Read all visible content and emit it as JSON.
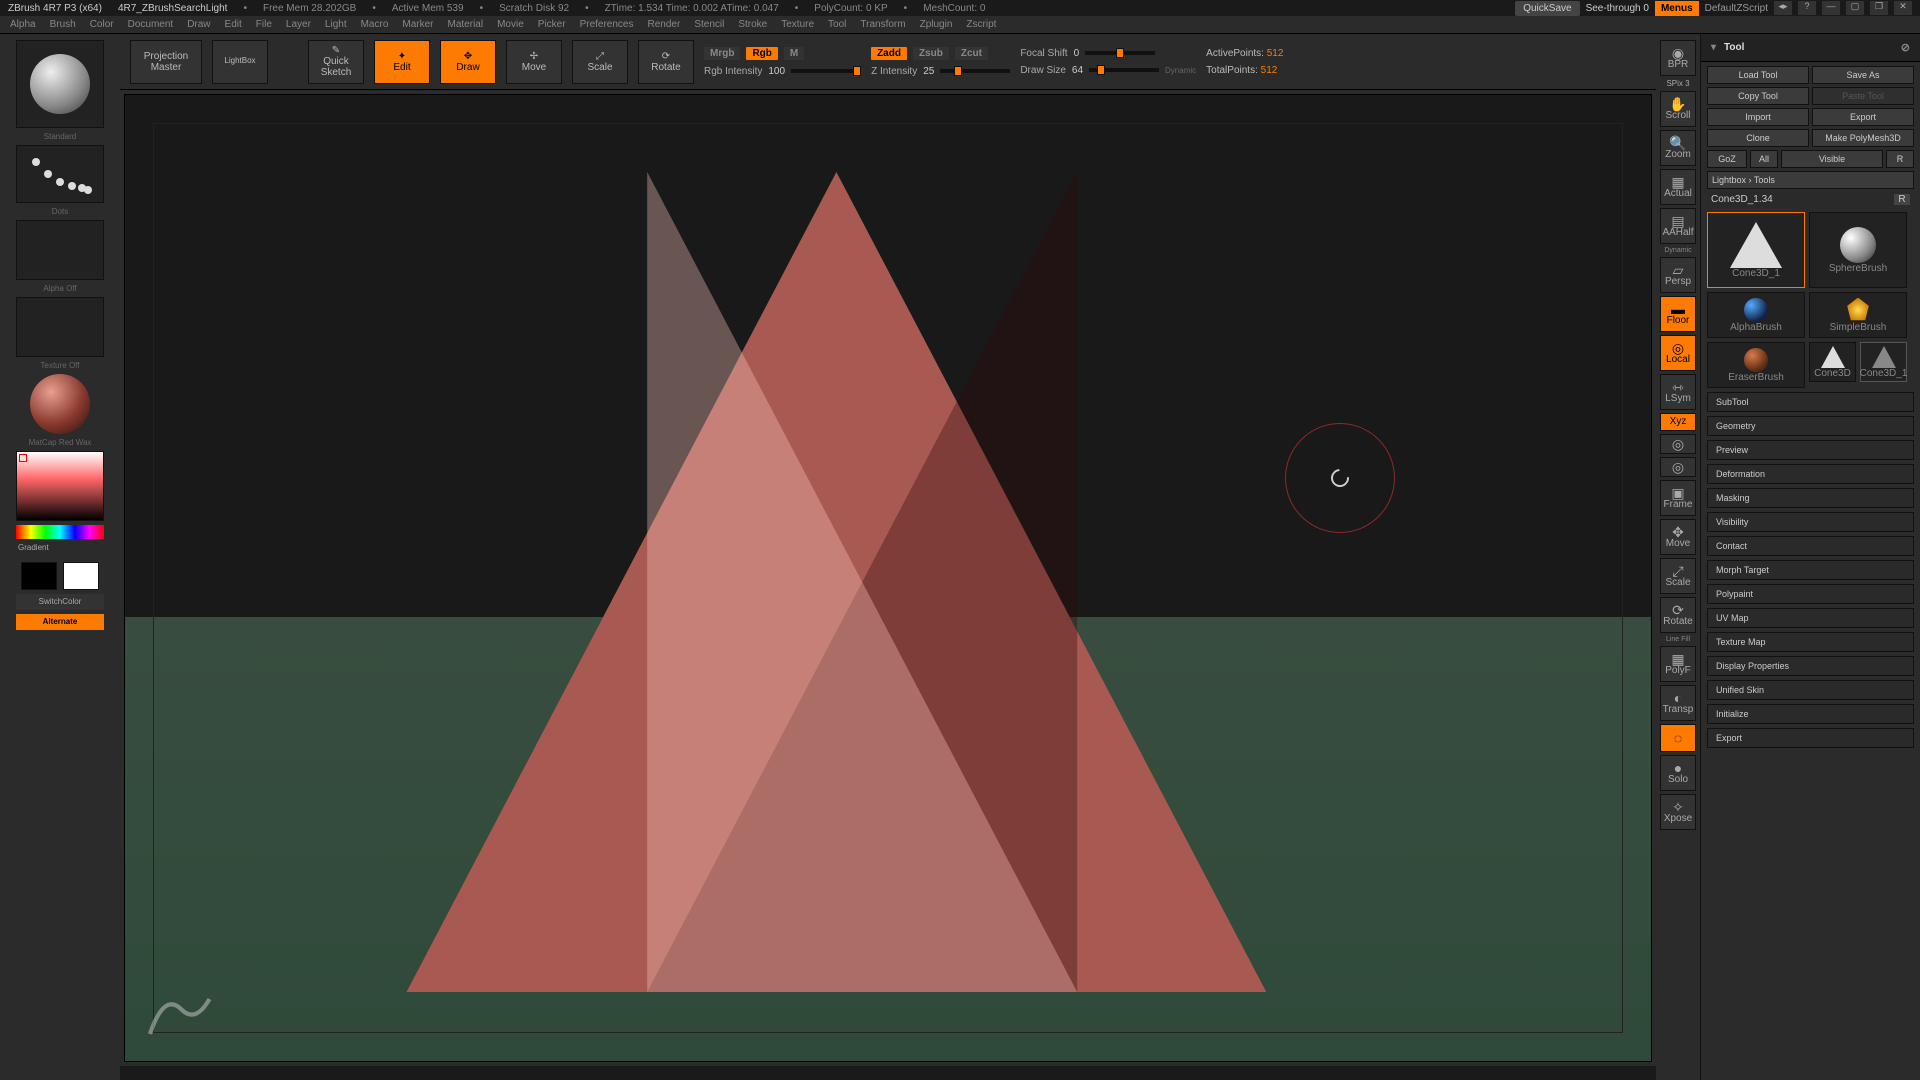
{
  "titlebar": {
    "app": "ZBrush 4R7 P3 (x64)",
    "doc": "4R7_ZBrushSearchLight",
    "stats": [
      "Free Mem 28.202GB",
      "Active Mem 539",
      "Scratch Disk 92",
      "ZTime: 1.534 Time: 0.002 ATime: 0.047",
      "PolyCount: 0 KP",
      "MeshCount: 0"
    ],
    "quicksave": "QuickSave",
    "seethrough": "See-through  0",
    "menus": "Menus",
    "skin": "DefaultZScript"
  },
  "menubar": [
    "Alpha",
    "Brush",
    "Color",
    "Document",
    "Draw",
    "Edit",
    "File",
    "Layer",
    "Light",
    "Macro",
    "Marker",
    "Material",
    "Movie",
    "Picker",
    "Preferences",
    "Render",
    "Stencil",
    "Stroke",
    "Texture",
    "Tool",
    "Transform",
    "Zplugin",
    "Zscript"
  ],
  "shelf": {
    "projection": "Projection\nMaster",
    "lightbox": "LightBox",
    "quicksketch": "Quick\nSketch",
    "edit": "Edit",
    "draw": "Draw",
    "move": "Move",
    "scale": "Scale",
    "rotate": "Rotate",
    "mrgb": "Mrgb",
    "rgb": "Rgb",
    "m": "M",
    "rgb_intensity_label": "Rgb Intensity",
    "rgb_intensity_val": "100",
    "zadd": "Zadd",
    "zsub": "Zsub",
    "zcut": "Zcut",
    "z_intensity_label": "Z Intensity",
    "z_intensity_val": "25",
    "focal_label": "Focal Shift",
    "focal_val": "0",
    "drawsize_label": "Draw Size",
    "drawsize_val": "64",
    "dynamic": "Dynamic",
    "active_pts_label": "ActivePoints:",
    "active_pts_val": "512",
    "total_pts_label": "TotalPoints:",
    "total_pts_val": "512"
  },
  "left": {
    "brush_label": "Standard",
    "stroke_label": "Dots",
    "alpha_label": "Alpha Off",
    "texture_label": "Texture Off",
    "material_label": "MatCap Red Wax",
    "gradient": "Gradient",
    "switchcolor": "SwitchColor",
    "alternate": "Alternate"
  },
  "right_tools": [
    "BPR",
    "SPix 3",
    "Scroll",
    "Zoom",
    "Actual",
    "AAHalf",
    "Dynamic",
    "Persp",
    "Floor",
    "Local",
    "LSym",
    "Xyz",
    "C",
    "C",
    "Frame",
    "Move",
    "Scale",
    "Rotate",
    "Line Fill",
    "PolyF",
    "Transp",
    "Ghost",
    "Solo",
    "Xpose"
  ],
  "tool_panel": {
    "title": "Tool",
    "load": "Load Tool",
    "saveas": "Save As",
    "copy": "Copy Tool",
    "paste": "Paste Tool",
    "import": "Import",
    "export_btn": "Export",
    "clone": "Clone",
    "makepoly": "Make PolyMesh3D",
    "goz": "GoZ",
    "all": "All",
    "visible": "Visible",
    "r1": "R",
    "lightbox_tools": "Lightbox › Tools",
    "current": "Cone3D_1.34",
    "r2": "R",
    "thumbs": [
      {
        "name": "Cone3D_1",
        "type": "cone",
        "active": true
      },
      {
        "name": "SphereBrush",
        "type": "sphere"
      },
      {
        "name": "AlphaBrush",
        "type": "alphab"
      },
      {
        "name": "SimpleBrush",
        "type": "simpleb"
      },
      {
        "name": "EraserBrush",
        "type": "eraserb"
      },
      {
        "name": "Cone3D",
        "type": "cone"
      },
      {
        "name": "Cone3D_1",
        "type": "cone-sel"
      }
    ],
    "sections": [
      "SubTool",
      "Geometry",
      "Preview",
      "Deformation",
      "Masking",
      "Visibility",
      "Contact",
      "Morph Target",
      "Polypaint",
      "UV Map",
      "Texture Map",
      "Display Properties",
      "Unified Skin",
      "Initialize",
      "Export"
    ]
  }
}
